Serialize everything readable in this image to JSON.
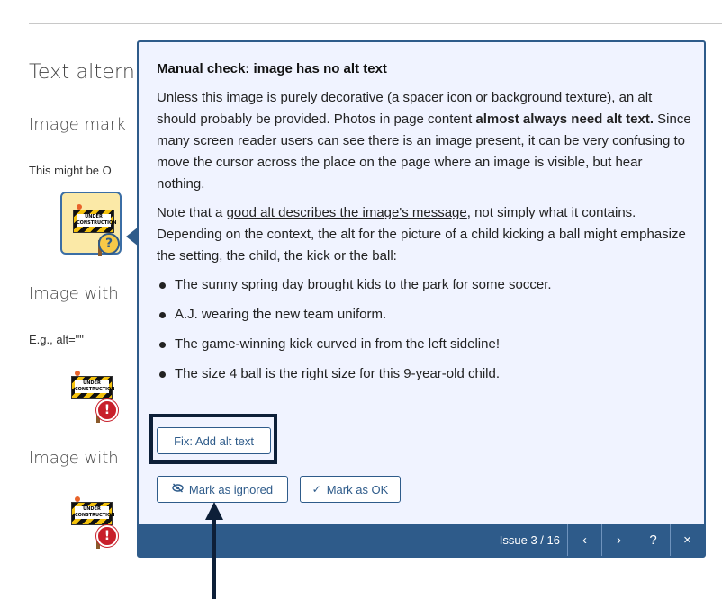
{
  "background": {
    "heading": "Text altern",
    "sections": [
      {
        "heading": "Image mark",
        "text": "This might be O"
      },
      {
        "heading": "Image with",
        "text": "E.g., alt=\"\""
      },
      {
        "heading": "Image with",
        "text": ""
      }
    ],
    "sign_label": "UNDER CONSTRUCTION",
    "badge_warning": "?",
    "badge_error": "!"
  },
  "panel": {
    "title": "Manual check: image has no alt text",
    "p1_a": "Unless this image is purely decorative (a spacer icon or background texture), an alt should probably be provided. Photos in page content ",
    "p1_bold": "almost always need alt text.",
    "p1_b": " Since many screen reader users can see there is an image present, it can be very confusing to move the cursor across the place on the page where an image is visible, but hear nothing.",
    "p2_a": "Note that a ",
    "p2_link": "good alt describes the image's message",
    "p2_b": ", not simply what it contains. Depending on the context, the alt for the picture of a child kicking a ball might emphasize the setting, the child, the kick or the ball:",
    "examples": [
      "The sunny spring day brought kids to the park for some soccer.",
      "A.J. wearing the new team uniform.",
      "The game-winning kick curved in from the left sideline!",
      "The size 4 ball is the right size for this 9-year-old child."
    ],
    "fix_label": "Fix: Add alt text",
    "ignore_label": "Mark as ignored",
    "ok_label": "Mark as OK",
    "ignore_icon": "eye-slash-icon",
    "ok_icon": "check-icon"
  },
  "footer": {
    "issue_text": "Issue 3 / 16",
    "prev": "‹",
    "next": "›",
    "help": "?",
    "close": "×"
  },
  "colors": {
    "accent": "#2e5b8a",
    "panel_bg": "#f0f3ff",
    "warning": "#f7c948",
    "error": "#c8202b",
    "annotation": "#0d1f38"
  }
}
